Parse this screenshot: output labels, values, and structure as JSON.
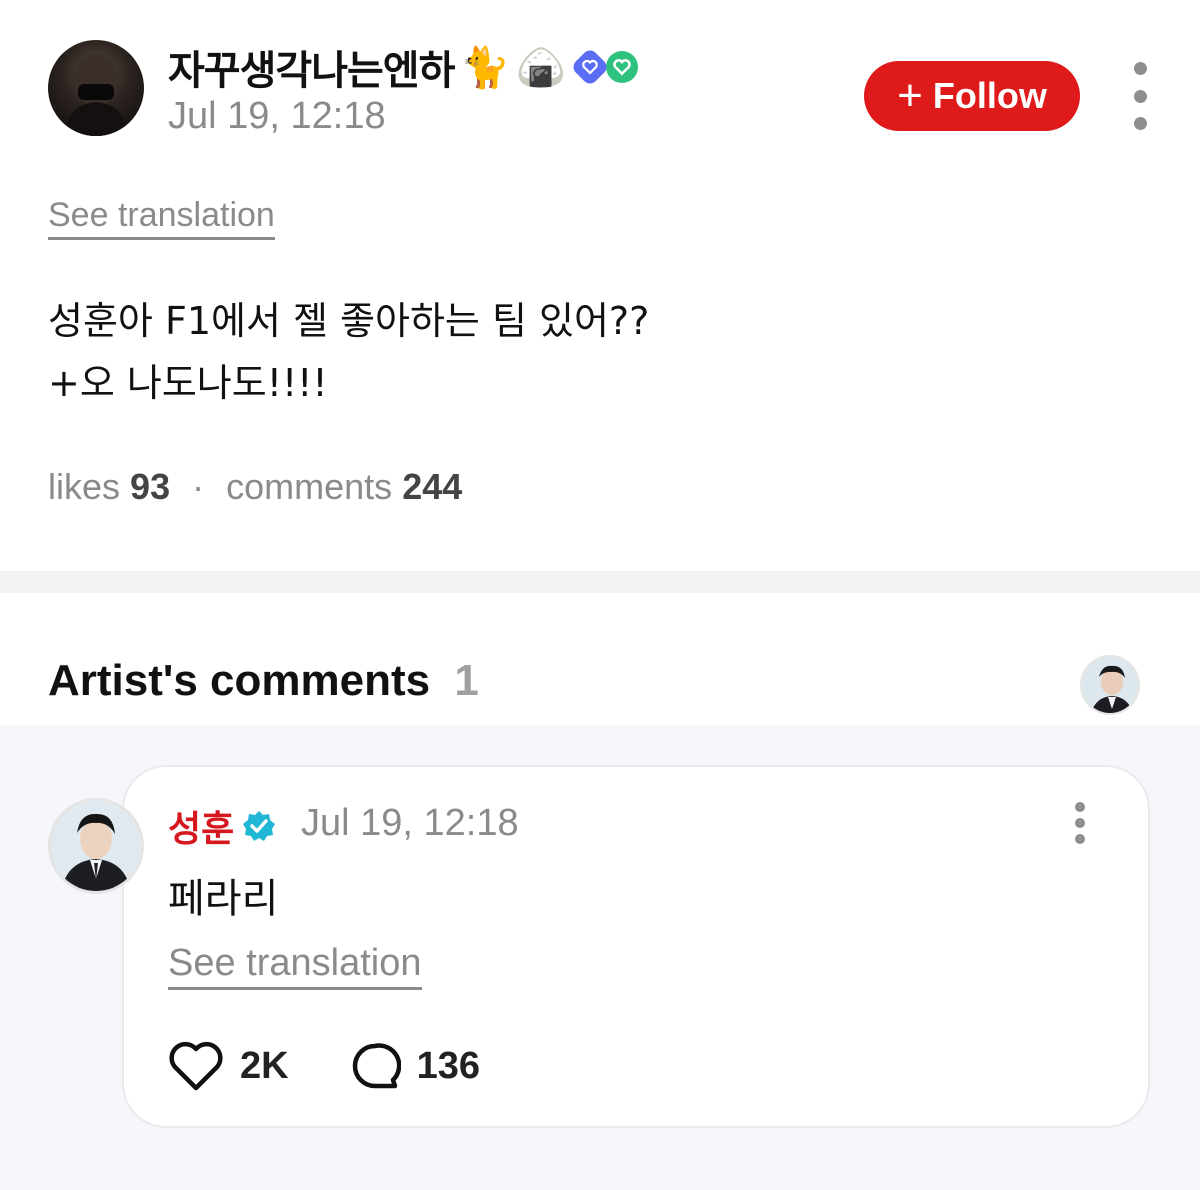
{
  "post": {
    "author": {
      "name": "자꾸생각나는엔하",
      "emojis": [
        "🐈",
        "🍙"
      ],
      "badges": [
        "blue-heart-badge",
        "green-heart-badge"
      ]
    },
    "time": "Jul 19, 12:18",
    "follow_label": "Follow",
    "see_translation": "See translation",
    "text_lines": [
      "성훈아 F1에서 젤 좋아하는 팀 있어??",
      "+오 나도나도!!!!"
    ],
    "stats": {
      "likes_label": "likes",
      "likes_count": "93",
      "separator": "·",
      "comments_label": "comments",
      "comments_count": "244"
    }
  },
  "artist_comments": {
    "title": "Artist's comments",
    "count": "1",
    "items": [
      {
        "author": "성훈",
        "verified": true,
        "time": "Jul 19, 12:18",
        "text": "페라리",
        "see_translation": "See translation",
        "likes": "2K",
        "replies": "136"
      }
    ]
  },
  "colors": {
    "accent_red": "#de1a1a",
    "artist_name": "#d6181e",
    "verified_badge": "#1fb7d4",
    "muted_text": "#8a8a8a",
    "section_bg": "#f6f7fb"
  },
  "icons": {
    "more": "more-vertical-icon",
    "like": "heart-outline-icon",
    "reply": "speech-bubble-icon",
    "verified": "verified-badge-icon"
  }
}
